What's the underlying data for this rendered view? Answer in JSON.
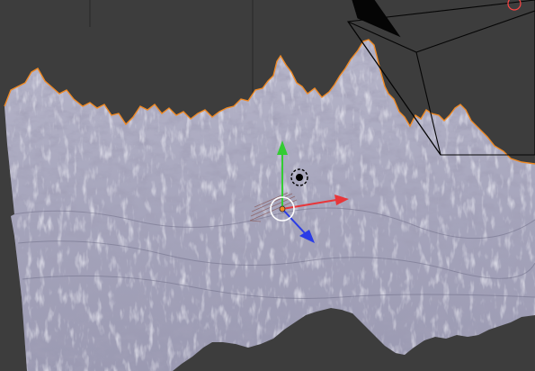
{
  "viewport": {
    "editor": "3D Viewport",
    "view_mode": "perspective",
    "background_color": "#3d3d3d",
    "grid_line_color": "#2e2e2e"
  },
  "scene": {
    "terrain": {
      "type": "mesh",
      "selected": true,
      "base_color": "#a9a8bd",
      "shadow_color": "#5c5b77",
      "highlight_color": "#eeeef6",
      "outline_color": "#f08a24"
    },
    "camera": {
      "wire_color": "#050505",
      "icon": "camera-icon"
    },
    "lamp": {
      "icon": "lamp-icon",
      "color": "#000000"
    },
    "transform_gizmo": {
      "axes": [
        {
          "axis": "x",
          "icon": "arrow-right-icon",
          "color": "#e8363a"
        },
        {
          "axis": "y",
          "icon": "arrow-up-icon",
          "color": "#33cc33"
        },
        {
          "axis": "z",
          "icon": "arrow-down-right-icon",
          "color": "#2a3ce6"
        }
      ],
      "center_color": "#f08a24",
      "ring_color": "#ffffff"
    },
    "cursor_3d": {
      "icon": "crosshair-icon",
      "colors": [
        "#ff2a2a",
        "#ffffff"
      ]
    }
  }
}
